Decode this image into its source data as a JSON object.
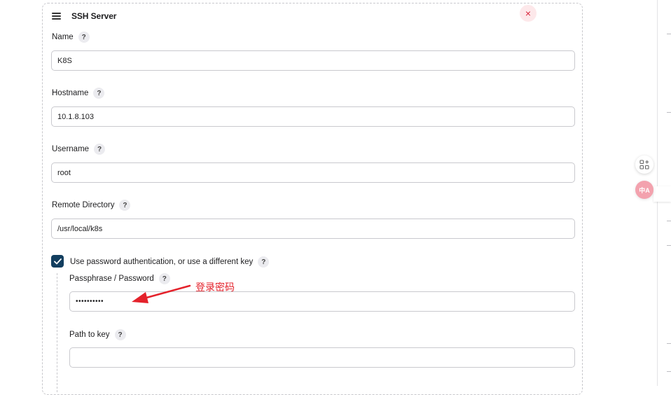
{
  "section": {
    "title": "SSH Server",
    "close_symbol": "×"
  },
  "fields": {
    "name": {
      "label": "Name",
      "value": "K8S"
    },
    "hostname": {
      "label": "Hostname",
      "value": "10.1.8.103"
    },
    "username": {
      "label": "Username",
      "value": "root"
    },
    "remote_directory": {
      "label": "Remote Directory",
      "value": "/usr/local/k8s"
    },
    "password": {
      "label": "Passphrase / Password",
      "value": "••••••••••"
    },
    "path_to_key": {
      "label": "Path to key",
      "value": ""
    }
  },
  "use_password_auth": {
    "label": "Use password authentication, or use a different key",
    "checked": true
  },
  "help_symbol": "?",
  "annotation": {
    "text": "登录密码",
    "color": "#e4222b"
  },
  "floating_tools": {
    "translate_label": "中A"
  },
  "colors": {
    "checkbox": "#123e5f",
    "close_bg": "#fde8ea",
    "close_fg": "#d9243a"
  }
}
